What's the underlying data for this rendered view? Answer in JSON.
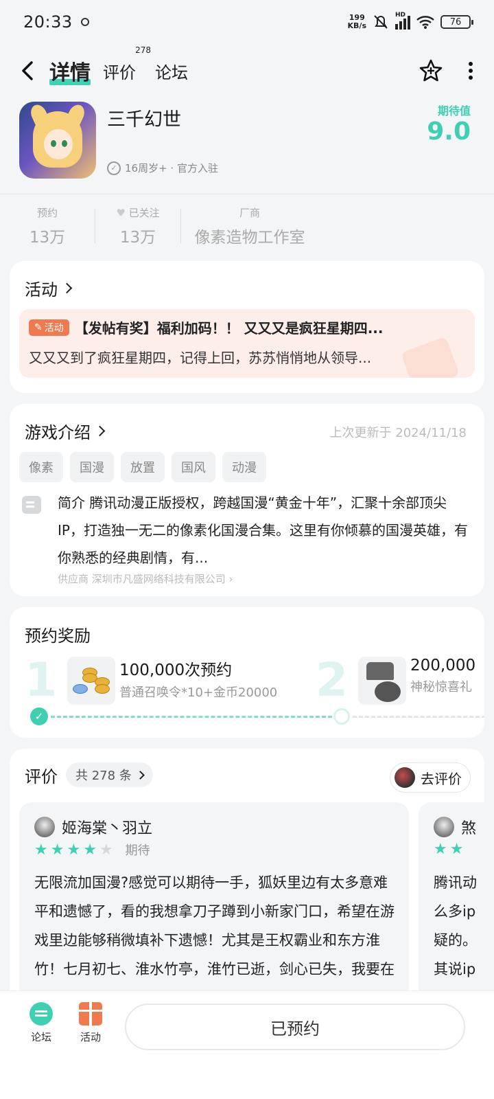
{
  "status": {
    "time": "20:33",
    "speed_top": "199",
    "speed_bottom": "KB/s",
    "signal": "HD",
    "battery": "76"
  },
  "nav": {
    "tabs": [
      {
        "label": "详情"
      },
      {
        "label": "评价",
        "count": "278"
      },
      {
        "label": "论坛"
      }
    ]
  },
  "game": {
    "title": "三千幻世",
    "cert": "16周岁+ · 官方入驻",
    "expect_label": "期待值",
    "expect_value": "9.0"
  },
  "stats": [
    {
      "label": "预约",
      "value": "13万"
    },
    {
      "label": "已关注",
      "value": "13万"
    },
    {
      "label": "厂商",
      "value": "像素造物工作室"
    }
  ],
  "activity": {
    "title": "活动",
    "badge": "活动",
    "headline": "【发帖有奖】福利加码！！ 又又又是疯狂星期四...",
    "body": "又又又到了疯狂星期四，记得上回，苏苏悄悄地从领导..."
  },
  "intro": {
    "title": "游戏介绍",
    "updated": "上次更新于 2024/11/18",
    "tags": [
      "像素",
      "国漫",
      "放置",
      "国风",
      "动漫"
    ],
    "text": "简介  腾讯动漫正版授权，跨越国漫“黄金十年”，汇聚十余部顶尖IP，打造独一无二的像素化国漫合集。这里有你倾慕的国漫英雄，有你熟悉的经典剧情，有...",
    "supplier": "供应商  深圳市凡盛网络科技有限公司 ›"
  },
  "rewards": {
    "title": "预约奖励",
    "items": [
      {
        "num": "1",
        "title": "100,000次预约",
        "desc": "普通召唤令*10+金币20000",
        "icon": "gold-coins-icon",
        "reached": true
      },
      {
        "num": "2",
        "title": "200,000",
        "desc": "神秘惊喜礼",
        "icon": "treasure-chest-icon",
        "reached": false
      }
    ],
    "progress": 0.5
  },
  "reviews": {
    "title": "评价",
    "count_label": "共 278 条",
    "action": "去评价",
    "items": [
      {
        "user": "姬海棠丶羽立",
        "rating": 4,
        "rating_label": "期待",
        "text": "无限流加国漫?感觉可以期待一手，狐妖里边有太多意难平和遗憾了，看的我想拿刀子蹲到小新家门口，希望在游戏里边能够稍微填补下遗憾！尤其是王权霸业和东方淮竹！七月初七、淮水竹亭，淮竹已逝，剑心已失，我要在游戏里边改变"
      },
      {
        "user": "煞",
        "rating": 2,
        "text": "腾讯动么多ip疑的。其说ip真正的"
      }
    ]
  },
  "bottom": {
    "forum": "论坛",
    "activity": "活动",
    "reserve": "已预约"
  }
}
